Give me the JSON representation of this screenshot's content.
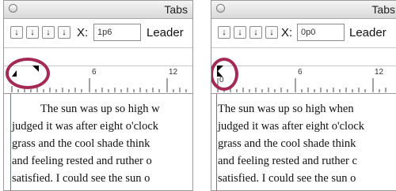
{
  "panels": [
    {
      "title": "Tabs",
      "x_label": "X:",
      "x_value": "1p6",
      "leader_label": "Leader",
      "ruler_numbers": [
        "6",
        "12"
      ],
      "lines": [
        "The sun was up so high w",
        "judged it was after eight o'clock",
        "grass and the cool shade think",
        "and feeling rested and ruther o",
        "satisfied. I could see the sun o"
      ]
    },
    {
      "title": "Tabs",
      "x_label": "X:",
      "x_value": "0p0",
      "leader_label": "Leader",
      "ruler_numbers": [
        "0",
        "6",
        "12"
      ],
      "lines": [
        "The sun was up so high when",
        "judged it was after eight o'clock",
        "grass and the cool shade think",
        "and feeling rested and ruther c",
        "satisfied. I could see the sun o"
      ]
    }
  ],
  "tab_buttons": [
    "left-justified",
    "center-justified",
    "right-justified",
    "decimal"
  ],
  "colors": {
    "highlight": "#a42a56",
    "guide": "#d2477a"
  }
}
